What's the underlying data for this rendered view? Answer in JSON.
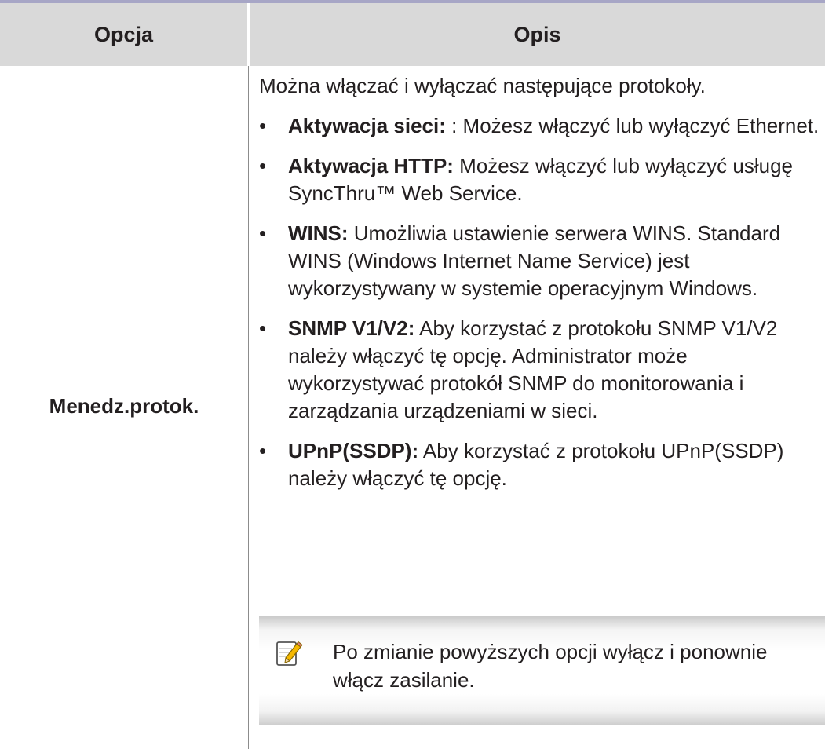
{
  "header": {
    "option": "Opcja",
    "description": "Opis"
  },
  "row": {
    "option": "Menedz.protok.",
    "intro": "Można włączać i wyłączać następujące protokoły.",
    "items": [
      {
        "term": "Aktywacja sieci:",
        "text": " : Możesz włączyć lub wyłączyć Ethernet."
      },
      {
        "term": "Aktywacja HTTP:",
        "text": " Możesz włączyć lub wyłączyć usługę SyncThru™ Web Service."
      },
      {
        "term": "WINS:",
        "text": " Umożliwia ustawienie serwera WINS. Standard WINS (Windows Internet Name Service) jest wykorzystywany w systemie operacyjnym Windows."
      },
      {
        "term": "SNMP V1/V2:",
        "text": " Aby korzystać z protokołu SNMP V1/V2 należy włączyć tę opcję. Administrator może wykorzystywać protokół SNMP do monitorowania i zarządzania urządzeniami w sieci."
      },
      {
        "term": "UPnP(SSDP):",
        "text": " Aby korzystać z protokołu UPnP(SSDP) należy włączyć tę opcję."
      }
    ],
    "note": {
      "icon": "note-pencil-icon",
      "text": "Po zmianie powyższych opcji wyłącz i ponownie włącz zasilanie."
    }
  }
}
